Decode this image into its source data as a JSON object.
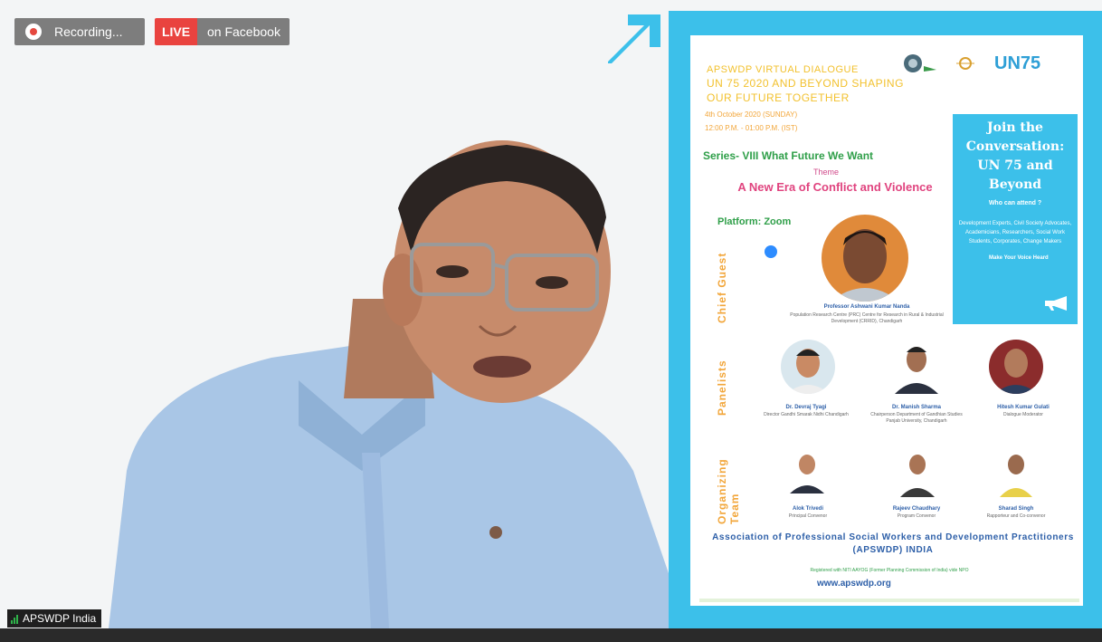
{
  "status": {
    "recording_label": "Recording...",
    "live_label": "LIVE",
    "live_target": "on Facebook"
  },
  "participant": {
    "name": "APSWDP India"
  },
  "poster": {
    "org_short": "APSWDP VIRTUAL DIALOGUE",
    "title_line1": "UN 75 2020 AND BEYOND SHAPING",
    "title_line2": "OUR FUTURE TOGETHER",
    "date": "4th October 2020 (SUNDAY)",
    "time": "12:00 P.M. - 01:00 P.M. (IST)",
    "un75_logo": "UN75",
    "series": "Series- VIII  What Future We Want",
    "theme_label": "Theme",
    "theme_title": "A New Era of Conflict and Violence",
    "platform": "Platform: Zoom",
    "side": {
      "title": "Join the Conversation: UN 75 and Beyond",
      "who": "Who can attend ?",
      "audience": "Development Experts, Civil Society Advocates, Academicians, Researchers, Social Work Students, Corporates, Change Makers",
      "voice": "Make Your Voice Heard"
    },
    "sections": {
      "chief_guest": "Chief Guest",
      "panelists": "Panelists",
      "organizing": "Organizing Team"
    },
    "chief_guest": {
      "name": "Professor Ashwani Kumar Nanda",
      "desc": "Population Research Centre (PRC) Centre for Research in Rural & Industrial Development (CRRID), Chandigarh"
    },
    "panelists": [
      {
        "name": "Dr. Devraj Tyagi",
        "desc": "Director Gandhi Smarak Nidhi Chandigarh"
      },
      {
        "name": "Dr. Manish Sharma",
        "desc": "Chairperson Department of Gandhian Studies Panjab University, Chandigarh"
      },
      {
        "name": "Hitesh Kumar Gulati",
        "desc": "Dialogue Moderator"
      }
    ],
    "organizers": [
      {
        "name": "Alok Trivedi",
        "desc": "Principal Convenor"
      },
      {
        "name": "Rajeev Chaudhary",
        "desc": "Program Convenor"
      },
      {
        "name": "Sharad Singh",
        "desc": "Rapporteur and Co-convenor"
      }
    ],
    "association": "Association of Professional Social Workers and Development Practitioners (APSWDP) INDIA",
    "registration": "Registered with NITI AAYOG (Former Planning Commission of India) vide NPO",
    "website": "www.apswdp.org"
  },
  "colors": {
    "poster_blue": "#3cc0ea",
    "live_red": "#e9433f",
    "pill_grey": "#7d7d7d",
    "shirt_blue": "#a9c6e6"
  }
}
